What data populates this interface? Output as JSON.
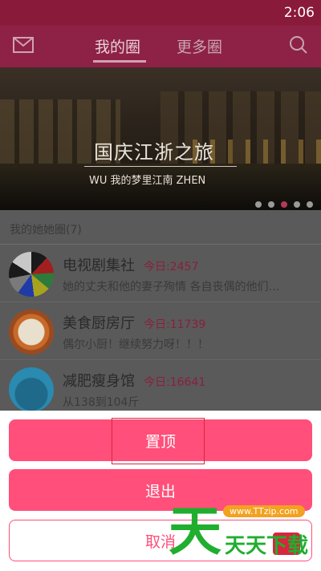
{
  "status_bar": {
    "time": "2:06"
  },
  "header": {
    "tabs": [
      {
        "label": "我的圈",
        "active": true
      },
      {
        "label": "更多圈",
        "active": false
      }
    ],
    "icons": [
      "mail-icon",
      "search-icon"
    ]
  },
  "banner": {
    "title": "国庆江浙之旅",
    "subtitle": "WU 我的梦里江南 ZHEN",
    "dots_total": 5,
    "dots_active_index": 2
  },
  "section": {
    "title": "我的她她圈(7)"
  },
  "circles": [
    {
      "name": "电视剧集社",
      "today": "今日:2457",
      "desc": "她的丈夫和他的妻子殉情 各自丧偶的他们…"
    },
    {
      "name": "美食厨房厅",
      "today": "今日:11739",
      "desc": "偶尔小厨！继续努力呀！！！"
    },
    {
      "name": "减肥瘦身馆",
      "today": "今日:16641",
      "desc": "从138到104斤"
    }
  ],
  "sheet": {
    "pin_label": "置顶",
    "exit_label": "退出",
    "cancel_label": "取消"
  },
  "watermark": {
    "big_char": "天",
    "url": "www.TTzip.com",
    "text": "天天下载"
  },
  "colors": {
    "accent": "#ff4f7a",
    "header": "#8e2246",
    "watermark_green": "#1fae2e"
  }
}
